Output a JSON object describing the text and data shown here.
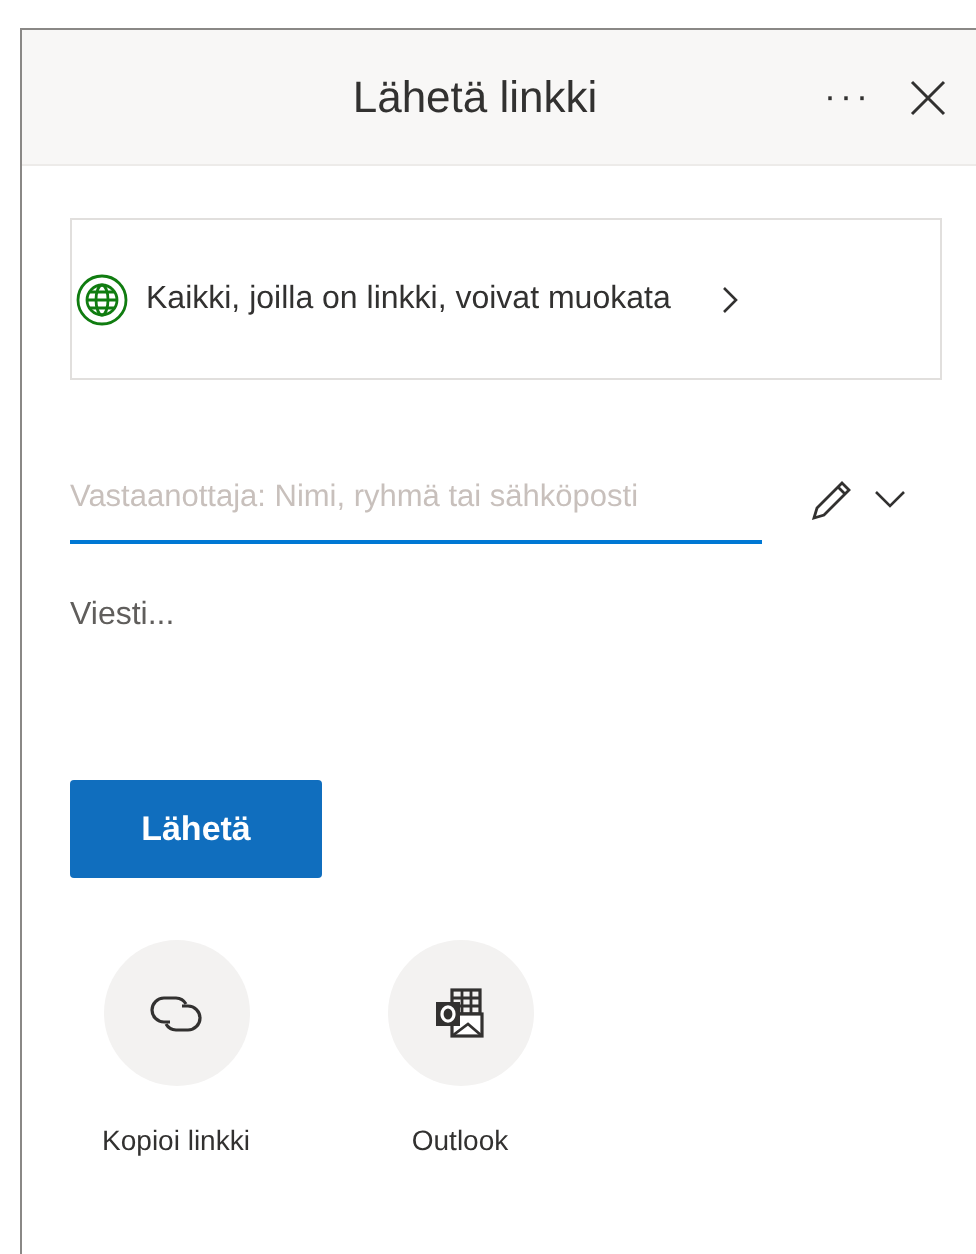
{
  "header": {
    "title": "Lähetä linkki",
    "more": "···"
  },
  "permission": {
    "label": "Kaikki, joilla on linkki, voivat muokata"
  },
  "recipient": {
    "placeholder": "Vastaanottaja: Nimi, ryhmä tai sähköposti"
  },
  "message": {
    "placeholder": "Viesti..."
  },
  "send_button": "Lähetä",
  "share_targets": [
    {
      "kind": "link",
      "label": "Kopioi linkki"
    },
    {
      "kind": "outlook",
      "label": "Outlook"
    }
  ]
}
